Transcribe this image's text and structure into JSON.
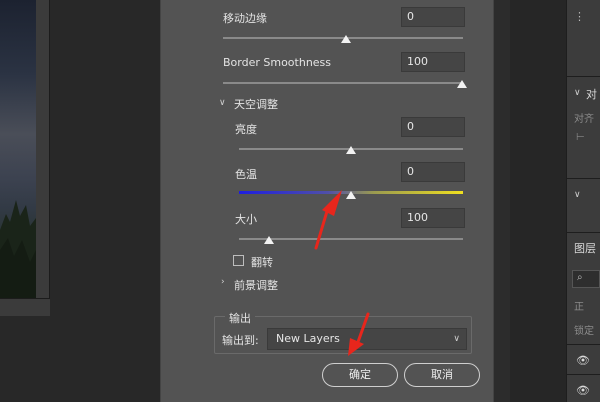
{
  "dialog": {
    "edge_shift": {
      "label": "移动边缘",
      "value": "0"
    },
    "border_smoothness": {
      "label": "Border Smoothness",
      "value": "100"
    },
    "sky_adjust": {
      "title": "天空调整",
      "brightness": {
        "label": "亮度",
        "value": "0"
      },
      "temperature": {
        "label": "色温",
        "value": "0"
      },
      "scale": {
        "label": "大小",
        "value": "100"
      },
      "flip": {
        "label": "翻转"
      }
    },
    "foreground_adjust": {
      "title": "前景调整"
    },
    "output": {
      "group_title": "输出",
      "output_to_label": "输出到:",
      "output_to_value": "New Layers"
    },
    "buttons": {
      "ok": "确定",
      "cancel": "取消"
    }
  },
  "right_panel": {
    "labels": [
      "对",
      "对齐",
      "图层",
      "正",
      "锁定"
    ]
  },
  "colors": {
    "dialog_bg": "#535353",
    "temp_gradient_start": "#1e1ee0",
    "temp_gradient_end": "#f0e020",
    "annotation": "#e8261c"
  }
}
